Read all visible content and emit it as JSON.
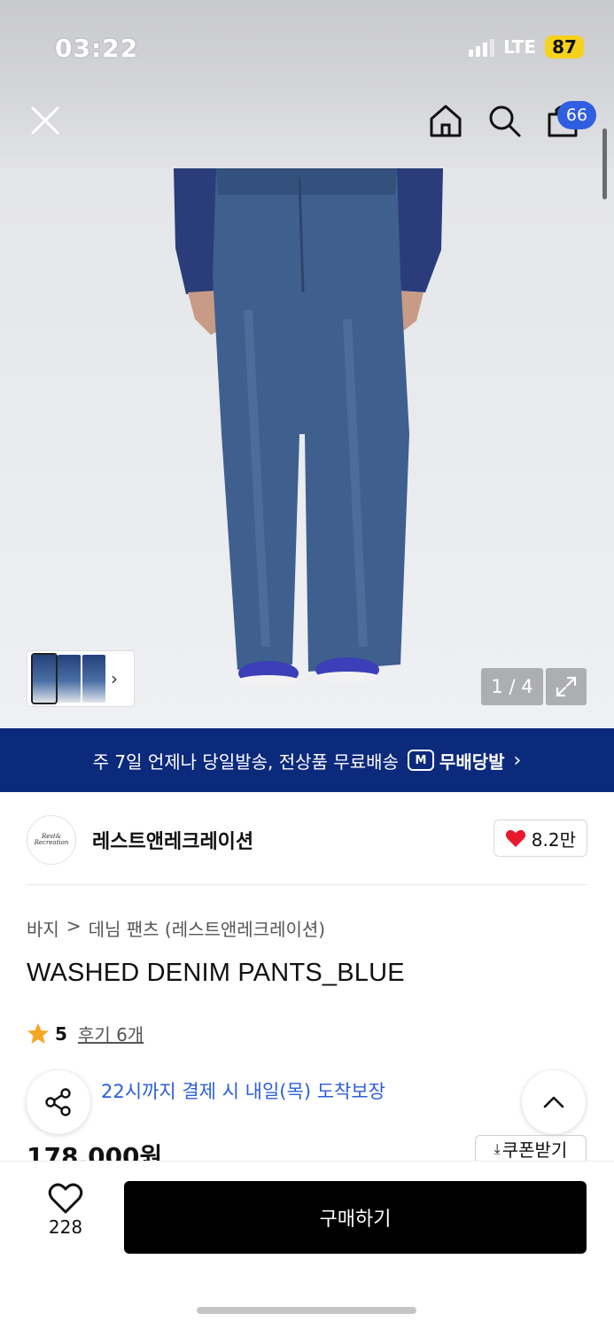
{
  "status": {
    "time": "03:22",
    "network": "LTE",
    "battery": "87"
  },
  "nav": {
    "cart_count": "66"
  },
  "gallery": {
    "counter": "1 / 4"
  },
  "banner": {
    "text": "주 7일 언제나 당일발송, 전상품 무료배송",
    "brand": "무배당발",
    "brand_badge": "M"
  },
  "brand": {
    "name": "레스트앤레크레이션",
    "logo_text": "Rest& Recreation",
    "likes": "8.2만"
  },
  "breadcrumb": {
    "category": "바지",
    "separator": ">",
    "subcategory": "데님 팬츠 (레스트앤레크레이션)"
  },
  "product": {
    "title": "WASHED DENIM PANTS_BLUE",
    "rating": "5",
    "reviews": "후기 6개",
    "delivery": "22시까지 결제 시 내일(목) 도착보장",
    "price": "178,000원",
    "coupon": "쿠폰받기"
  },
  "bottom": {
    "wish_count": "228",
    "buy_label": "구매하기"
  },
  "colors": {
    "accent": "#2f5fe0",
    "banner": "#0c2a7c",
    "buy": "#000000",
    "heart": "#e8192c",
    "star": "#f5a623",
    "battery": "#f6d21c"
  }
}
